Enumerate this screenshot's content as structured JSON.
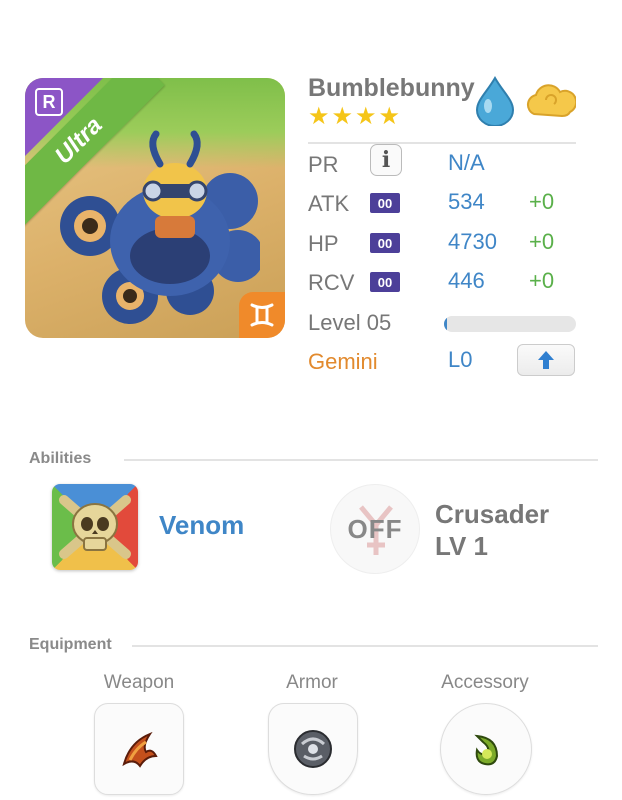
{
  "monster": {
    "name": "Bumblebunny",
    "stars": 4,
    "rarity": "Ultra",
    "rarity_badge": "R",
    "element_icon": "water-drop-icon",
    "element_color": "#4aa8d8",
    "secondary_icon": "cloud-icon",
    "sign_icon": "gemini-icon"
  },
  "stats": {
    "pr": {
      "label": "PR",
      "value": "N/A"
    },
    "atk": {
      "label": "ATK",
      "box": "00",
      "value": "534",
      "bonus": "+0"
    },
    "hp": {
      "label": "HP",
      "box": "00",
      "value": "4730",
      "bonus": "+0"
    },
    "rcv": {
      "label": "RCV",
      "box": "00",
      "value": "446",
      "bonus": "+0"
    }
  },
  "level": {
    "label": "Level 05",
    "progress": 0.02
  },
  "sign": {
    "label": "Gemini",
    "value": "L0"
  },
  "abilities": {
    "title": "Abilities",
    "ability_name": "Venom",
    "skill_state": "OFF",
    "skill_name_line1": "Crusader",
    "skill_name_line2": "LV 1"
  },
  "equipment": {
    "title": "Equipment",
    "slots": [
      {
        "label": "Weapon",
        "icon": "claw-weapon-icon"
      },
      {
        "label": "Armor",
        "icon": "orb-armor-icon"
      },
      {
        "label": "Accessory",
        "icon": "leaf-accessory-icon"
      }
    ]
  },
  "colors": {
    "accent_blue": "#3f86c7",
    "bonus_green": "#5ab04a",
    "sign_orange": "#e28a2e",
    "stat_box_purple": "#4c3f99",
    "ultra_green": "#6fb845",
    "star_gold": "#f5c518"
  }
}
